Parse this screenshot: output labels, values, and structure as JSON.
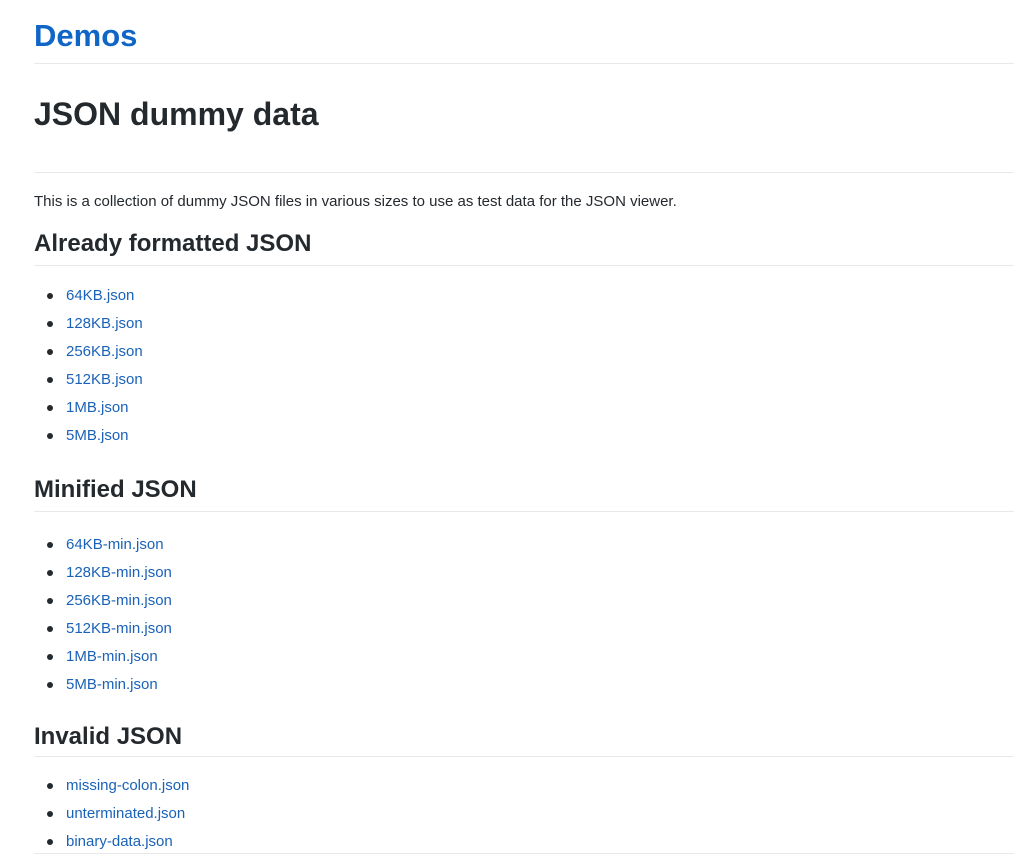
{
  "header": {
    "site_title": "Demos"
  },
  "page": {
    "title": "JSON dummy data",
    "intro": "This is a collection of dummy JSON files in various sizes to use as test data for the JSON viewer."
  },
  "sections": [
    {
      "title": "Already formatted JSON",
      "files": [
        "64KB.json",
        "128KB.json",
        "256KB.json",
        "512KB.json",
        "1MB.json",
        "5MB.json"
      ]
    },
    {
      "title": "Minified JSON",
      "files": [
        "64KB-min.json",
        "128KB-min.json",
        "256KB-min.json",
        "512KB-min.json",
        "1MB-min.json",
        "5MB-min.json"
      ]
    },
    {
      "title": "Invalid JSON",
      "files": [
        "missing-colon.json",
        "unterminated.json",
        "binary-data.json"
      ]
    }
  ],
  "colors": {
    "link": "#1a62b8",
    "site_title": "#0f66c7",
    "text": "#24292e",
    "rule": "#e8e8e8"
  }
}
